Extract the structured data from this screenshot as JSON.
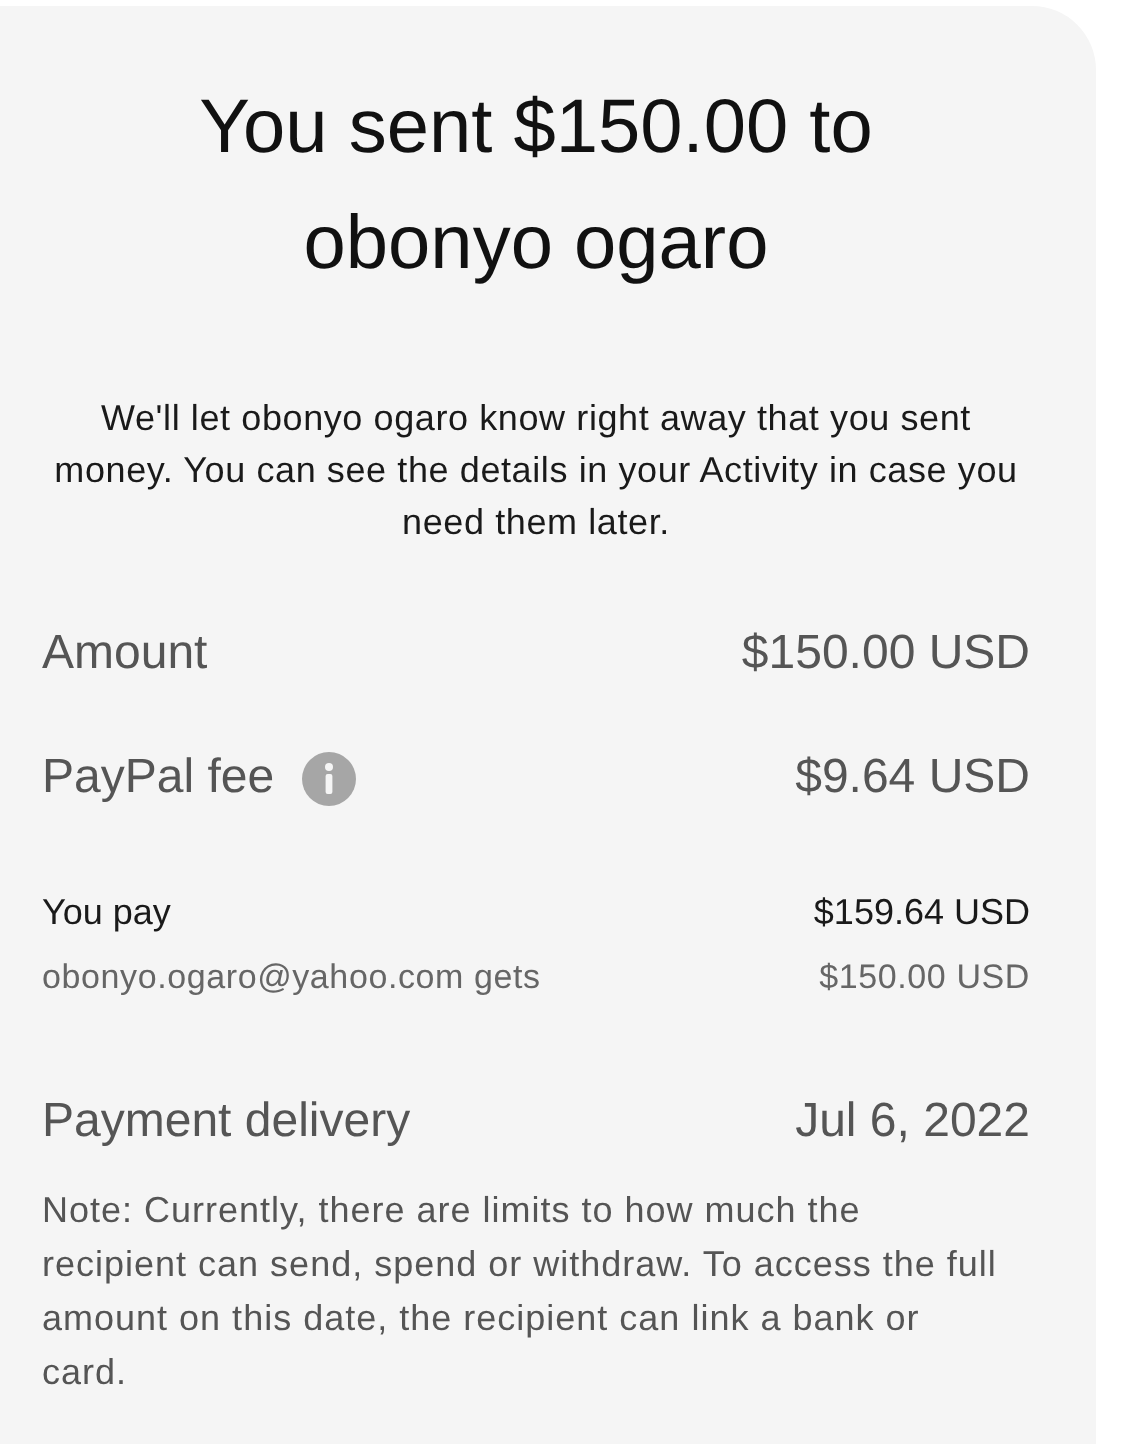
{
  "title": "You sent $150.00 to obonyo ogaro",
  "message": "We'll let obonyo ogaro know right away that you sent money. You can see the details in your Activity in case you need them later.",
  "rows": [
    {
      "kind": "main",
      "label": "Amount",
      "value": "$150.00 USD",
      "info": false
    },
    {
      "kind": "main",
      "label": "PayPal fee",
      "value": "$9.64 USD",
      "info": true
    },
    {
      "kind": "total",
      "label": "You pay",
      "value": "$159.64 USD",
      "info": false
    },
    {
      "kind": "sub",
      "label": "obonyo.ogaro@yahoo.com gets",
      "value": "$150.00 USD",
      "info": false
    },
    {
      "kind": "main",
      "label": "Payment delivery",
      "value": "Jul 6, 2022",
      "info": false
    }
  ],
  "note": "Note: Currently, there are limits to how much the recipient can send, spend or withdraw. To access the full amount on this date, the recipient can link a bank or card."
}
